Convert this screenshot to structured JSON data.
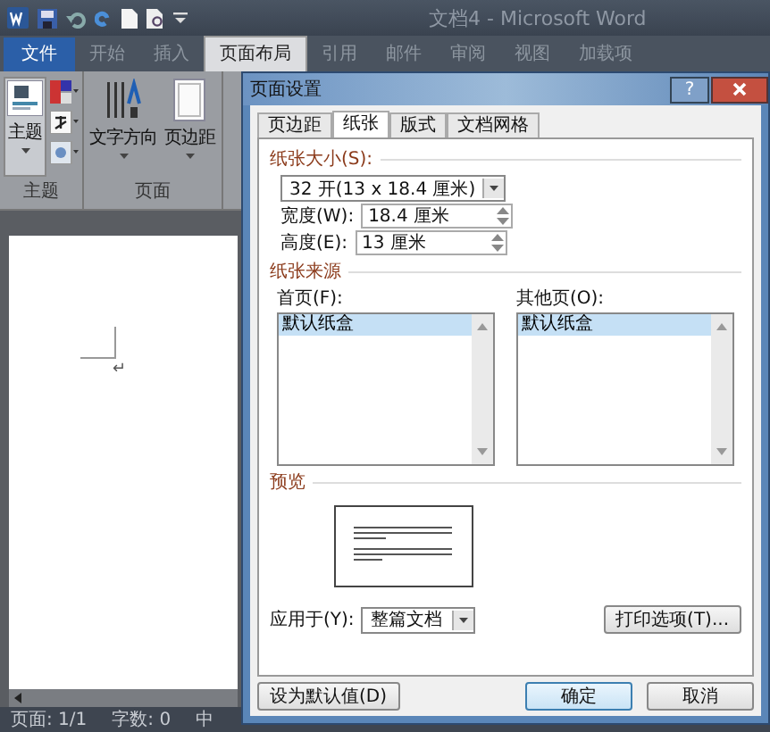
{
  "word": {
    "title": "文档4 - Microsoft Word",
    "ribbon_tabs": [
      {
        "label": "文件",
        "kind": "file",
        "selected": false
      },
      {
        "label": "开始",
        "kind": "tab",
        "selected": false
      },
      {
        "label": "插入",
        "kind": "tab",
        "selected": false
      },
      {
        "label": "页面布局",
        "kind": "tab",
        "selected": true
      },
      {
        "label": "引用",
        "kind": "tab",
        "selected": false
      },
      {
        "label": "邮件",
        "kind": "tab",
        "selected": false
      },
      {
        "label": "审阅",
        "kind": "tab",
        "selected": false
      },
      {
        "label": "视图",
        "kind": "tab",
        "selected": false
      },
      {
        "label": "加载项",
        "kind": "tab",
        "selected": false
      }
    ],
    "ribbon_groups": [
      {
        "label": "主题",
        "buttons": [
          {
            "label": "主题",
            "kind": "theme"
          }
        ]
      },
      {
        "label": "页面",
        "buttons": [
          {
            "label": "文字方向",
            "kind": "text-direction"
          },
          {
            "label": "页边距",
            "kind": "margins"
          }
        ]
      }
    ],
    "paragraph_mark": "↵",
    "status_bar": [
      "页面: 1/1",
      "字数: 0",
      "中"
    ]
  },
  "dialog": {
    "title": "页面设置",
    "help": "?",
    "tabs": [
      {
        "label": "页边距",
        "selected": false
      },
      {
        "label": "纸张",
        "selected": true
      },
      {
        "label": "版式",
        "selected": false
      },
      {
        "label": "文档网格",
        "selected": false
      }
    ],
    "paper_size": {
      "heading": "纸张大小(S):",
      "preset": "32 开(13 x 18.4 厘米)",
      "fields": [
        {
          "label": "宽度(W):",
          "value": "18.4 厘米"
        },
        {
          "label": "高度(E):",
          "value": "13 厘米"
        }
      ]
    },
    "paper_source": {
      "heading": "纸张来源",
      "lists": [
        {
          "label": "首页(F):",
          "items": [
            {
              "label": "默认纸盒",
              "selected": true
            }
          ]
        },
        {
          "label": "其他页(O):",
          "items": [
            {
              "label": "默认纸盒",
              "selected": true
            }
          ]
        }
      ]
    },
    "preview": {
      "heading": "预览"
    },
    "apply_to": {
      "label": "应用于(Y):",
      "value": "整篇文档"
    },
    "print_options": "打印选项(T)...",
    "buttons": [
      {
        "label": "设为默认值(D)",
        "kind": "left"
      },
      {
        "label": "确定",
        "kind": "default"
      },
      {
        "label": "取消",
        "kind": "normal"
      }
    ]
  }
}
